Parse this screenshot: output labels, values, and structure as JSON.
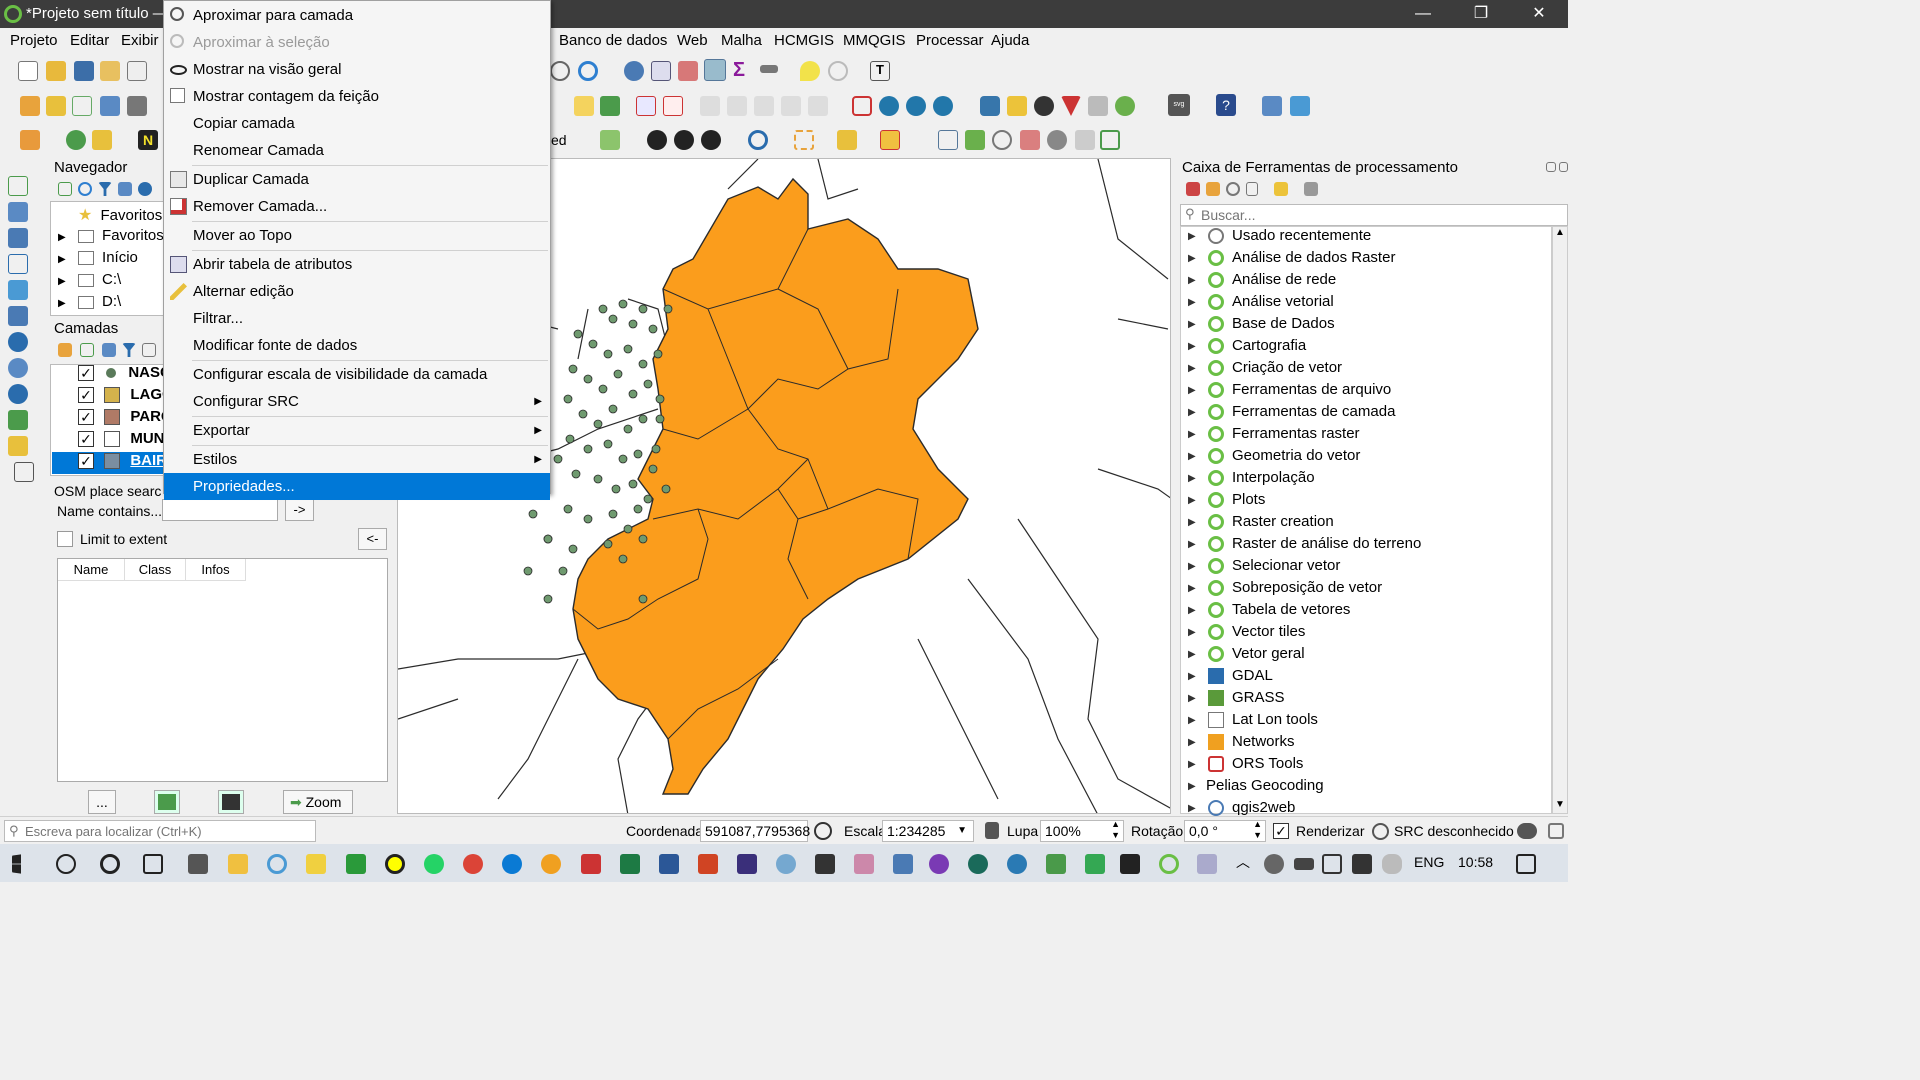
{
  "window": {
    "title": "*Projeto sem título —",
    "minimize": "—",
    "maximize": "❐",
    "close": "✕"
  },
  "menubar": {
    "left": [
      "Projeto",
      "Editar",
      "Exibir"
    ],
    "right": [
      "Banco de dados",
      "Web",
      "Malha",
      "HCMGIS",
      "MMQGIS",
      "Processar",
      "Ajuda"
    ]
  },
  "toolbar_partial_text": "ed",
  "browser": {
    "title": "Navegador",
    "items": [
      {
        "label": "Favoritos",
        "icon": "star-icon"
      },
      {
        "label": "Favoritos",
        "icon": "folder-icon"
      },
      {
        "label": "Início",
        "icon": "home-icon"
      },
      {
        "label": "C:\\",
        "icon": "folder-icon"
      },
      {
        "label": "D:\\",
        "icon": "folder-icon"
      }
    ]
  },
  "layers": {
    "title": "Camadas",
    "items": [
      {
        "label": "NASC",
        "checked": "✓",
        "swatch": "#5a7a5a",
        "dot": true
      },
      {
        "label": "LAGO",
        "checked": "✓",
        "swatch": "#d4b24c"
      },
      {
        "label": "PARQ",
        "checked": "✓",
        "swatch": "#b07a66"
      },
      {
        "label": "MUNI",
        "checked": "✓",
        "swatch": "#ffffff"
      },
      {
        "label": "BAIRI",
        "checked": "✓",
        "swatch": "#7b8ea0",
        "selected": true
      }
    ]
  },
  "osm": {
    "title": "OSM place searc",
    "name_label": "Name contains...",
    "go_button": "->",
    "limit_label": "Limit to extent",
    "back_button": "<-",
    "columns": [
      "Name",
      "Class",
      "Infos"
    ],
    "dots_button": "...",
    "zoom_button": "Zoom"
  },
  "context_menu": {
    "items": [
      {
        "label": "Aproximar para camada",
        "icon": "zoom-layer-icon"
      },
      {
        "label": "Aproximar à seleção",
        "icon": "zoom-selection-icon",
        "disabled": true
      },
      {
        "label": "Mostrar na visão geral",
        "icon": "overview-icon"
      },
      {
        "label": "Mostrar contagem da feição",
        "icon": "checkbox-icon"
      },
      {
        "label": "Copiar camada"
      },
      {
        "label": "Renomear Camada"
      },
      {
        "sep": true
      },
      {
        "label": "Duplicar Camada",
        "icon": "duplicate-icon"
      },
      {
        "label": "Remover Camada...",
        "icon": "remove-layer-icon"
      },
      {
        "sep": true
      },
      {
        "label": "Mover ao Topo"
      },
      {
        "sep": true
      },
      {
        "label": "Abrir tabela de atributos",
        "icon": "table-icon"
      },
      {
        "label": "Alternar edição",
        "icon": "pencil-icon"
      },
      {
        "label": "Filtrar..."
      },
      {
        "label": "Modificar fonte de dados"
      },
      {
        "sep": true
      },
      {
        "label": "Configurar escala de visibilidade da camada"
      },
      {
        "label": "Configurar SRC",
        "submenu": true
      },
      {
        "sep": true
      },
      {
        "label": "Exportar",
        "submenu": true
      },
      {
        "sep": true
      },
      {
        "label": "Estilos",
        "submenu": true
      },
      {
        "label": "Propriedades...",
        "selected": true
      }
    ]
  },
  "processing": {
    "title": "Caixa de Ferramentas de processamento",
    "search_placeholder": "Buscar...",
    "items": [
      {
        "label": "Usado recentemente",
        "icon": "clock-icon"
      },
      {
        "label": "Análise de dados Raster",
        "icon": "qgis-icon"
      },
      {
        "label": "Análise de rede",
        "icon": "qgis-icon"
      },
      {
        "label": "Análise vetorial",
        "icon": "qgis-icon"
      },
      {
        "label": "Base de Dados",
        "icon": "qgis-icon"
      },
      {
        "label": "Cartografia",
        "icon": "qgis-icon"
      },
      {
        "label": "Criação de vetor",
        "icon": "qgis-icon"
      },
      {
        "label": "Ferramentas de arquivo",
        "icon": "qgis-icon"
      },
      {
        "label": "Ferramentas de camada",
        "icon": "qgis-icon"
      },
      {
        "label": "Ferramentas raster",
        "icon": "qgis-icon"
      },
      {
        "label": "Geometria do vetor",
        "icon": "qgis-icon"
      },
      {
        "label": "Interpolação",
        "icon": "qgis-icon"
      },
      {
        "label": "Plots",
        "icon": "qgis-icon"
      },
      {
        "label": "Raster creation",
        "icon": "qgis-icon"
      },
      {
        "label": "Raster de análise do terreno",
        "icon": "qgis-icon"
      },
      {
        "label": "Selecionar vetor",
        "icon": "qgis-icon"
      },
      {
        "label": "Sobreposição de vetor",
        "icon": "qgis-icon"
      },
      {
        "label": "Tabela de vetores",
        "icon": "qgis-icon"
      },
      {
        "label": "Vector tiles",
        "icon": "qgis-icon"
      },
      {
        "label": "Vetor geral",
        "icon": "qgis-icon"
      },
      {
        "label": "GDAL",
        "icon": "gdal-icon"
      },
      {
        "label": "GRASS",
        "icon": "grass-icon"
      },
      {
        "label": "Lat Lon tools",
        "icon": "latlon-icon"
      },
      {
        "label": "Networks",
        "icon": "networks-icon"
      },
      {
        "label": "ORS Tools",
        "icon": "ors-icon"
      },
      {
        "label": "Pelias Geocoding",
        "icon": ""
      },
      {
        "label": "qgis2web",
        "icon": "qgis2web-icon"
      }
    ]
  },
  "statusbar": {
    "locate_placeholder": "Escreva para localizar (Ctrl+K)",
    "coord_label": "Coordenada",
    "coord_value": "591087,7795368",
    "scale_label": "Escala",
    "scale_value": "1:234285",
    "magnifier_label": "Lupa",
    "magnifier_value": "100%",
    "rotation_label": "Rotação",
    "rotation_value": "0,0 °",
    "render_label": "Renderizar",
    "crs_label": "SRC desconhecido"
  },
  "taskbar": {
    "lang": "ENG",
    "time": "10:58"
  },
  "colors": {
    "map_fill": "#fb9d1c",
    "map_stroke": "#2b2b2b",
    "points": "#6f9a6f",
    "selection": "#0078d7",
    "qgis_green": "#6abf45"
  }
}
